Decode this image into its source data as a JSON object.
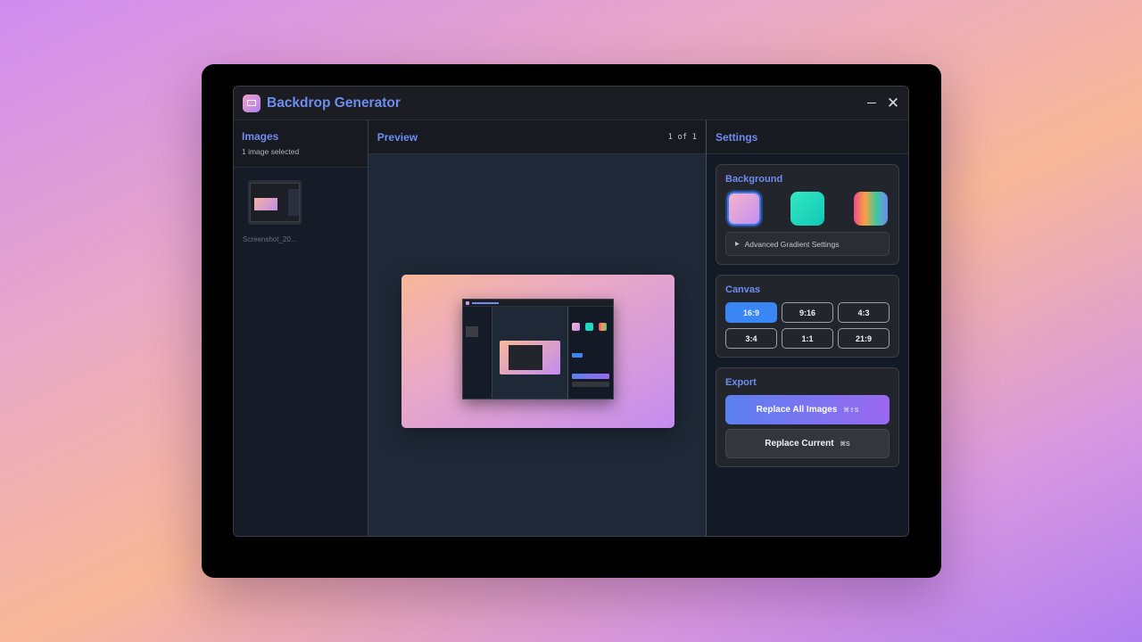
{
  "app": {
    "title": "Backdrop Generator"
  },
  "images_panel": {
    "title": "Images",
    "selection": "1 image selected",
    "items": [
      {
        "name": "Screenshot_20..."
      }
    ]
  },
  "preview": {
    "title": "Preview",
    "counter": "1 of 1"
  },
  "settings": {
    "title": "Settings",
    "background": {
      "title": "Background",
      "swatches": [
        {
          "name": "peach-purple-gradient",
          "selected": true,
          "colors": [
            "#f5b4c8",
            "#c490f4"
          ]
        },
        {
          "name": "aqua-gradient",
          "selected": false,
          "colors": [
            "#34e8c0",
            "#10c8b8"
          ]
        },
        {
          "name": "rainbow-gradient",
          "selected": false,
          "colors": [
            "#f04a8a",
            "#f8a040",
            "#40c8a0",
            "#7088f0"
          ]
        }
      ],
      "advanced_label": "Advanced Gradient Settings"
    },
    "canvas": {
      "title": "Canvas",
      "ratios": [
        "16:9",
        "9:16",
        "4:3",
        "3:4",
        "1:1",
        "21:9"
      ],
      "selected": "16:9"
    },
    "export": {
      "title": "Export",
      "replace_all_label": "Replace All Images",
      "replace_all_shortcut": "⌘⇧S",
      "replace_current_label": "Replace Current",
      "replace_current_shortcut": "⌘S"
    }
  },
  "colors": {
    "accent": "#6e8cf0",
    "selected": "#3a86f4"
  }
}
